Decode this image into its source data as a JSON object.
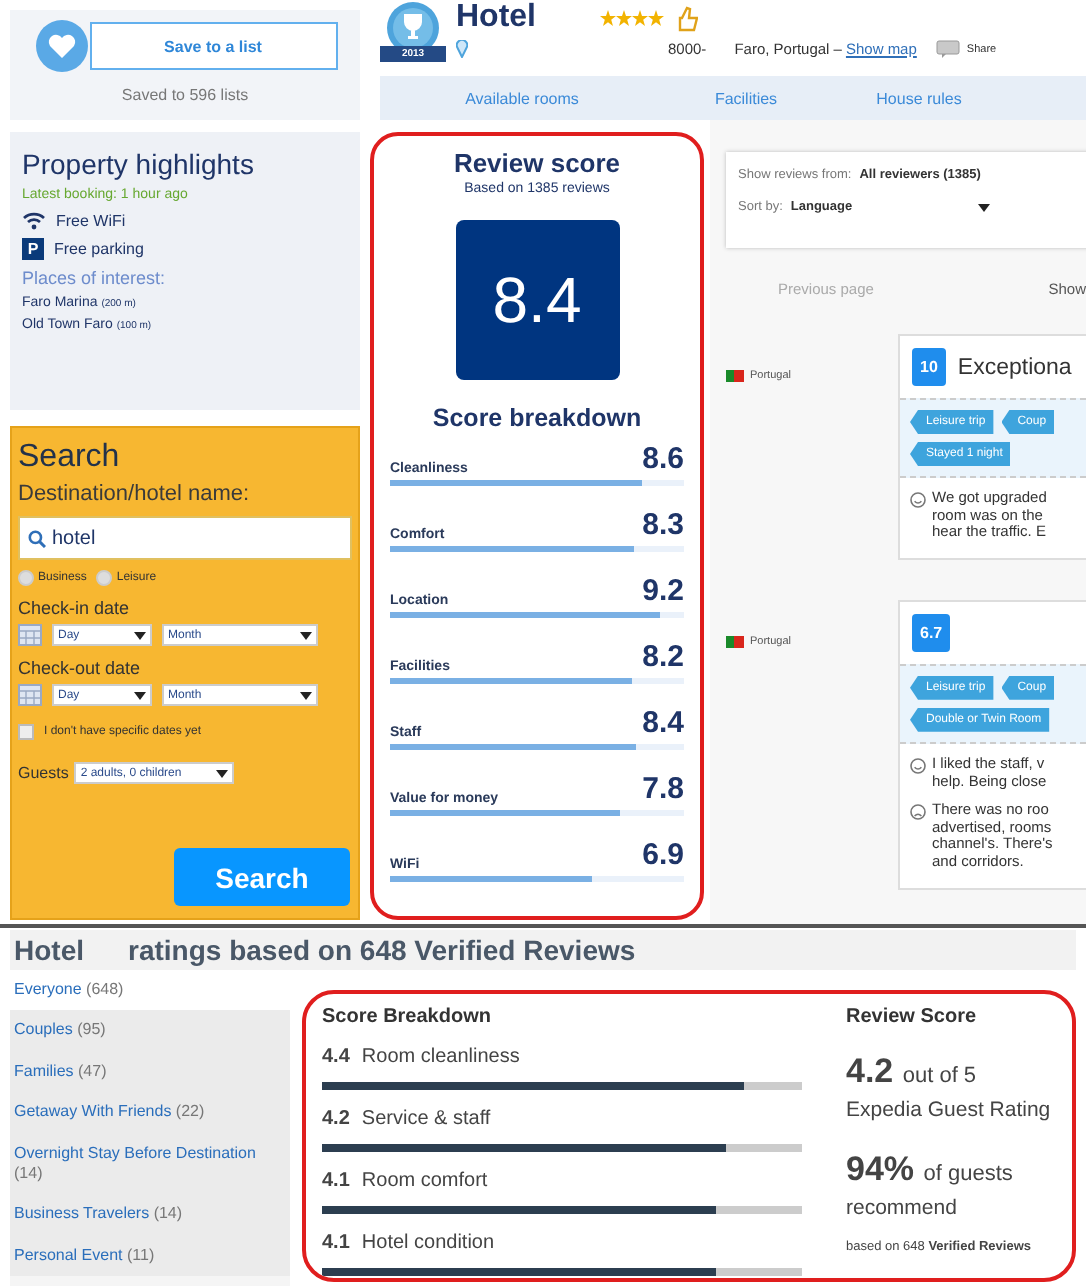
{
  "save": {
    "button": "Save to a list",
    "count": "Saved to 596 lists"
  },
  "hotel": {
    "badge_year": "2013",
    "name": "Hotel",
    "stars": 4,
    "postcode": "8000-",
    "address": "Faro, Portugal –",
    "map_link": "Show map",
    "share": "Share"
  },
  "tabs": [
    {
      "label": "Available rooms",
      "selected": false
    },
    {
      "label": "Facilities",
      "selected": false
    },
    {
      "label": "House rules",
      "selected": false
    }
  ],
  "highlights": {
    "title": "Property highlights",
    "latest_booking": "Latest booking: 1 hour ago",
    "amenities": [
      {
        "kind": "wifi",
        "label": "Free WiFi"
      },
      {
        "kind": "parking",
        "icon": "P",
        "label": "Free parking"
      }
    ],
    "places_title": "Places of interest:",
    "places": [
      {
        "name": "Faro Marina",
        "distance": "(200 m)"
      },
      {
        "name": "Old Town Faro",
        "distance": "(100 m)"
      }
    ]
  },
  "search": {
    "title": "Search",
    "destination_label": "Destination/hotel name:",
    "destination_value": "hotel",
    "trip_types": [
      {
        "label": "Business",
        "selected": false
      },
      {
        "label": "Leisure",
        "selected": false
      }
    ],
    "checkin_label": "Check-in date",
    "checkin": {
      "day": "Day",
      "month": "Month"
    },
    "checkout_label": "Check-out date",
    "checkout": {
      "day": "Day",
      "month": "Month"
    },
    "no_dates": {
      "label": "I don't have specific dates yet",
      "checked": false
    },
    "guests_label": "Guests",
    "guests_value": "2 adults, 0 children",
    "button": "Search"
  },
  "review_score": {
    "title": "Review score",
    "subtitle": "Based on 1385 reviews",
    "score": "8.4",
    "breakdown_title": "Score breakdown",
    "categories": [
      {
        "name": "Cleanliness",
        "score": "8.6",
        "level": 0.86
      },
      {
        "name": "Comfort",
        "score": "8.3",
        "level": 0.83
      },
      {
        "name": "Location",
        "score": "9.2",
        "level": 0.92
      },
      {
        "name": "Facilities",
        "score": "8.2",
        "level": 0.82
      },
      {
        "name": "Staff",
        "score": "8.4",
        "level": 0.84
      },
      {
        "name": "Value for money",
        "score": "7.8",
        "level": 0.78
      },
      {
        "name": "WiFi",
        "score": "6.9",
        "level": 0.69
      }
    ]
  },
  "reviews": {
    "filter_label": "Show reviews from:",
    "filter_value": "All reviewers (1385)",
    "sort_label": "Sort by:",
    "sort_value": "Language",
    "previous": "Previous page",
    "next": "Show",
    "items": [
      {
        "country": "Portugal",
        "score": "10",
        "headline": "Exceptiona",
        "tags": [
          "Leisure trip",
          "Coup",
          "Stayed 1 night"
        ],
        "comments": [
          {
            "kind": "positive",
            "lines": [
              "We got upgraded",
              "room was on the",
              "hear the traffic. E"
            ]
          }
        ]
      },
      {
        "country": "Portugal",
        "score": "6.7",
        "tags": [
          "Leisure trip",
          "Coup",
          "Double or Twin Room"
        ],
        "comments": [
          {
            "kind": "positive",
            "lines": [
              "I liked the staff, v",
              "help. Being close"
            ]
          },
          {
            "kind": "negative",
            "lines": [
              "There was no roo",
              "advertised, rooms",
              "channel's. There's",
              "and corridors."
            ]
          }
        ]
      }
    ]
  },
  "guest_ratings": {
    "title": "Hotel",
    "subtitle": "ratings based on 648 Verified Reviews",
    "segments": [
      {
        "label": "Everyone",
        "count": "(648)",
        "selected": true
      },
      {
        "label": "Couples",
        "count": "(95)",
        "selected": false
      },
      {
        "label": "Families",
        "count": "(47)",
        "selected": false
      },
      {
        "label": "Getaway With Friends",
        "count": "(22)",
        "selected": false
      },
      {
        "label": "Overnight Stay Before Destination",
        "count": "(14)",
        "selected": false
      },
      {
        "label": "Business Travelers",
        "count": "(14)",
        "selected": false
      },
      {
        "label": "Personal Event",
        "count": "(11)",
        "selected": false
      }
    ],
    "breakdown_title": "Score Breakdown",
    "categories": [
      {
        "score": "4.4",
        "name": "Room cleanliness",
        "level": 0.88
      },
      {
        "score": "4.2",
        "name": "Service & staff",
        "level": 0.84
      },
      {
        "score": "4.1",
        "name": "Room comfort",
        "level": 0.82
      },
      {
        "score": "4.1",
        "name": "Hotel condition",
        "level": 0.82
      }
    ],
    "review_title": "Review Score",
    "rating": "4.2",
    "rating_suffix": "out of 5",
    "rating_label": "Expedia Guest Rating",
    "recommend_pct": "94%",
    "recommend_text": "of guests",
    "recommend_text2": "recommend",
    "based_on": "based on 648 **Verified Reviews**"
  }
}
